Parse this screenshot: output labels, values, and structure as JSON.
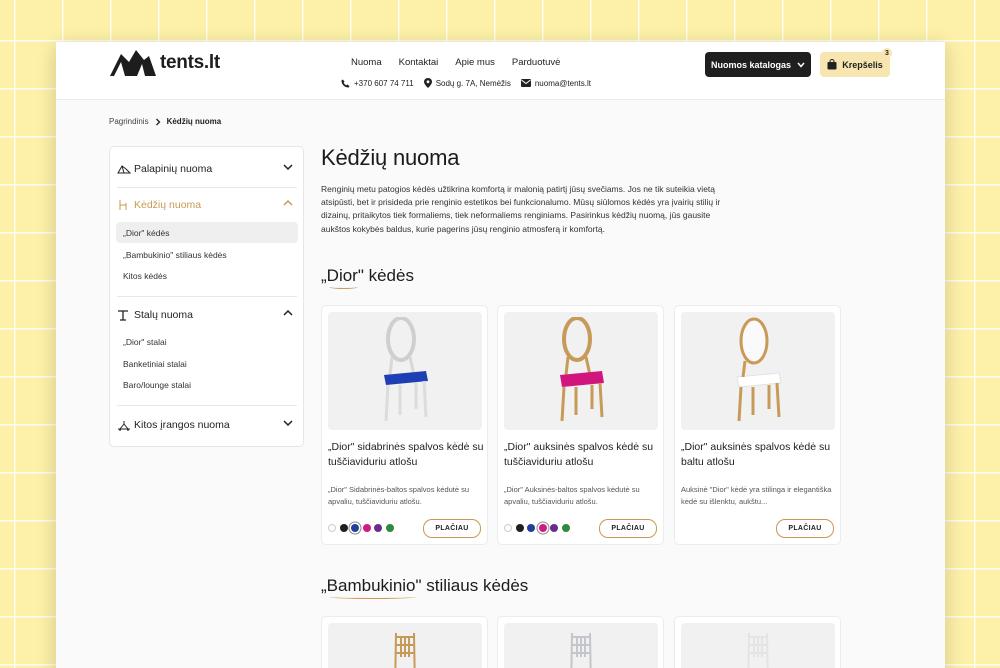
{
  "brand": {
    "name": "tents.lt"
  },
  "nav": {
    "items": [
      "Nuoma",
      "Kontaktai",
      "Apie mus",
      "Parduotuvė"
    ]
  },
  "contacts": {
    "phone": "+370 607 74 711",
    "address": "Sodų g. 7A, Nemėžis",
    "email": "nuoma@tents.lt"
  },
  "header": {
    "catalog_label": "Nuomos katalogas",
    "cart_label": "Krepšelis",
    "cart_count": "3"
  },
  "breadcrumb": {
    "home": "Pagrindinis",
    "current": "Kėdžių nuoma"
  },
  "sidebar": {
    "categories": [
      {
        "label": "Palapinių nuoma"
      },
      {
        "label": "Kėdžių nuoma",
        "subs": [
          "„Dior\" kėdės",
          "„Bambukinio\" stiliaus kėdės",
          "Kitos kėdės"
        ]
      },
      {
        "label": "Stalų nuoma",
        "subs": [
          "„Dior\" stalai",
          "Banketiniai stalai",
          "Baro/lounge stalai"
        ]
      },
      {
        "label": "Kitos įrangos nuoma"
      }
    ]
  },
  "main": {
    "title": "Kėdžių nuoma",
    "intro": "Renginių metu patogios kėdės užtikrina komfortą ir malonią patirtį jūsų svečiams. Jos ne tik suteikia vietą atsipūsti, bet ir prisideda prie renginio estetikos bei funkcionalumo. Mūsų siūlomos kėdės yra įvairių stilių ir dizainų, pritaikytos tiek formaliems, tiek neformaliems renginiams. Pasirinkus kėdžių nuomą, jūs gausite aukštos kokybės baldus, kurie pagerins jūsų renginio atmosferą ir komfortą.",
    "section1": {
      "quote": "„",
      "title": "Dior",
      "rest": "\" kėdės"
    },
    "section2": {
      "quote": "„",
      "title": "Bambukinio",
      "rest": "\" stiliaus kėdės"
    },
    "more_label": "PLAČIAU",
    "products": [
      {
        "title": "„Dior\" sidabrinės spalvos kėdė su tuščiaviduriu atlošu",
        "desc": "„Dior\" Sidabrinės-baltos spalvos kėdutė su apvaliu, tuščiaviduriu atlošu.",
        "frame_color": "#d6d6d6",
        "seat_color": "#1d3fb3"
      },
      {
        "title": "„Dior\" auksinės spalvos kėdė su tuščiaviduriu atlošu",
        "desc": "„Dior\" Auksinės-baltos spalvos kėdutė su apvaliu, tuščiaviduriu atlošu.",
        "frame_color": "#c89a58",
        "seat_color": "#d1157f"
      },
      {
        "title": "„Dior\" auksinės spalvos kėdė su baltu atlošu",
        "desc": "Auksinė \"Dior\" kėdė yra stilinga ir elegantiška kėdė su išlenktu, aukštu...",
        "frame_color": "#c89a58",
        "seat_color": "#ffffff"
      }
    ],
    "swatch_colors": [
      "#ffffff",
      "#1f1f1f",
      "#233f9c",
      "#d11a85",
      "#6a2d8f",
      "#2f8a3a"
    ],
    "selected_swatch": [
      2,
      3,
      -1
    ]
  },
  "colors": {
    "accent": "#c99a53",
    "dark_button": "#1f1f1f",
    "cart_bg": "#f7e6b0"
  }
}
